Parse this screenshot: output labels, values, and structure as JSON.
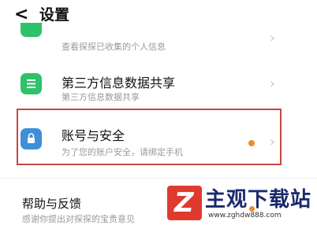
{
  "header": {
    "back_glyph": "<",
    "title": "设置"
  },
  "items": [
    {
      "label": "",
      "subtitle": "查看探探已收集的个人信息",
      "icon": "green-square-icon"
    },
    {
      "label": "第三方信息数据共享",
      "subtitle": "第三方信息数据共享",
      "icon": "list-icon"
    },
    {
      "label": "账号与安全",
      "subtitle": "为了您的账户安全，请绑定手机",
      "icon": "lock-icon"
    },
    {
      "label": "帮助与反馈",
      "subtitle": "感谢你提出对探探的宝贵意见"
    }
  ],
  "watermark": {
    "title": "主观下载站",
    "url": "www.zghdw888.com"
  },
  "colors": {
    "green": "#2ec26b",
    "blue": "#3d8fd9",
    "orange_dot": "#f08a2b",
    "highlight": "#c64644"
  }
}
